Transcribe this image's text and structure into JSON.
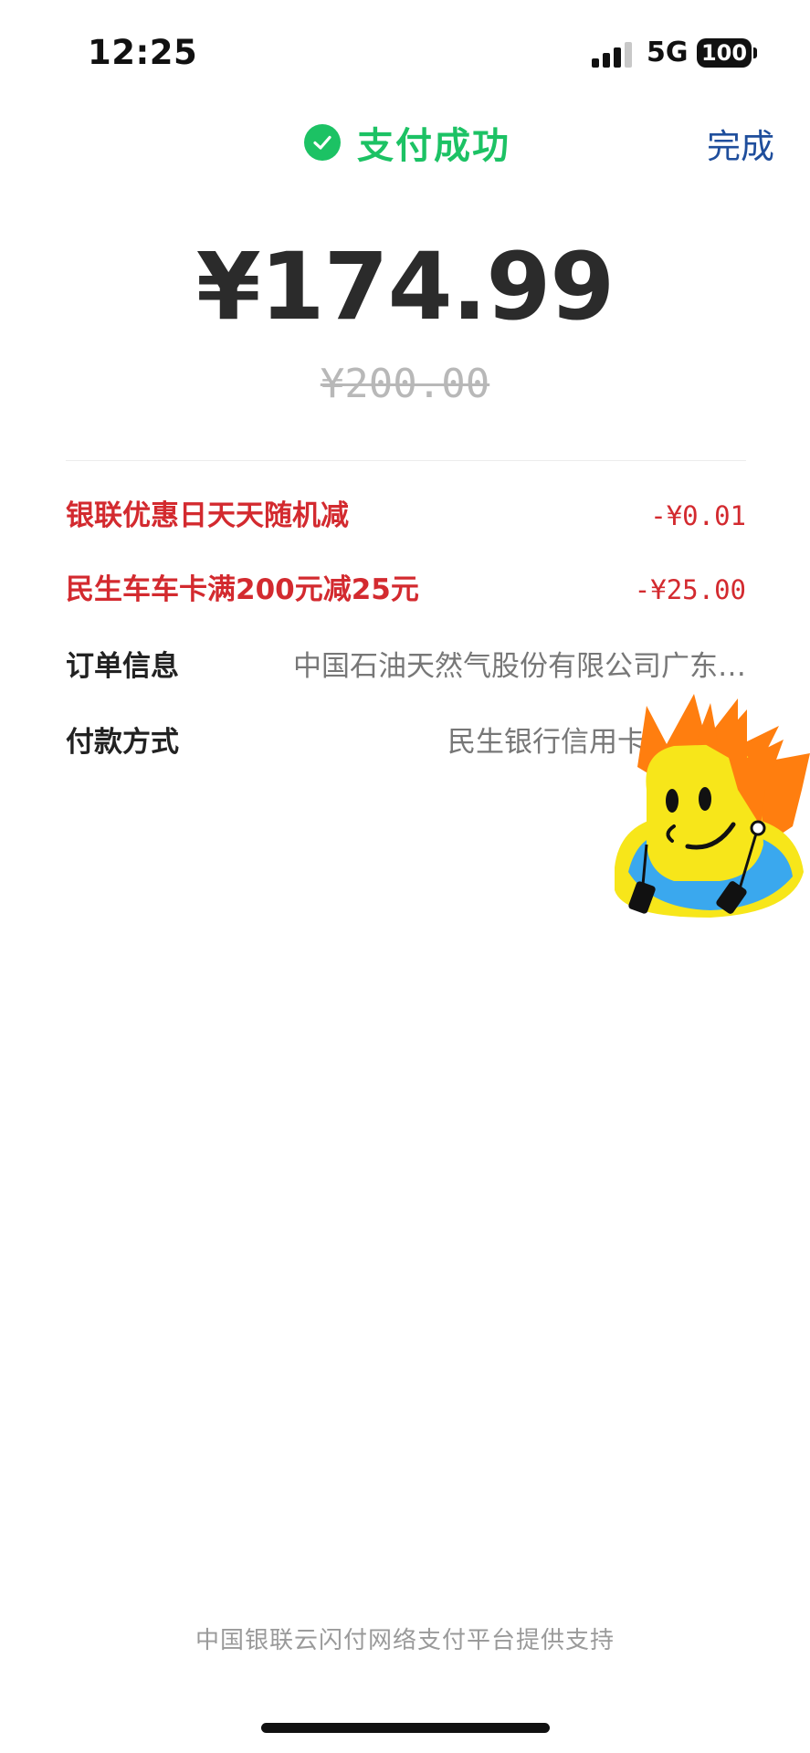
{
  "status_bar": {
    "time": "12:25",
    "network": "5G",
    "battery": "100"
  },
  "header": {
    "status_text": "支付成功",
    "done_label": "完成",
    "status_icon": "check-circle-icon"
  },
  "payment": {
    "amount": "¥174.99",
    "original_amount": "¥200.00"
  },
  "discounts": [
    {
      "label": "银联优惠日天天随机减",
      "value": "-¥0.01"
    },
    {
      "label": "民生车车卡满200元减25元",
      "value": "-¥25.00"
    }
  ],
  "details": [
    {
      "label": "订单信息",
      "value": "中国石油天然气股份有限公司广东…"
    },
    {
      "label": "付款方式",
      "value": "民生银行信用卡"
    }
  ],
  "footer": {
    "text": "中国银联云闪付网络支付平台提供支持"
  },
  "colors": {
    "success": "#1cc264",
    "link": "#1f4e9c",
    "discount": "#d32a2f"
  }
}
